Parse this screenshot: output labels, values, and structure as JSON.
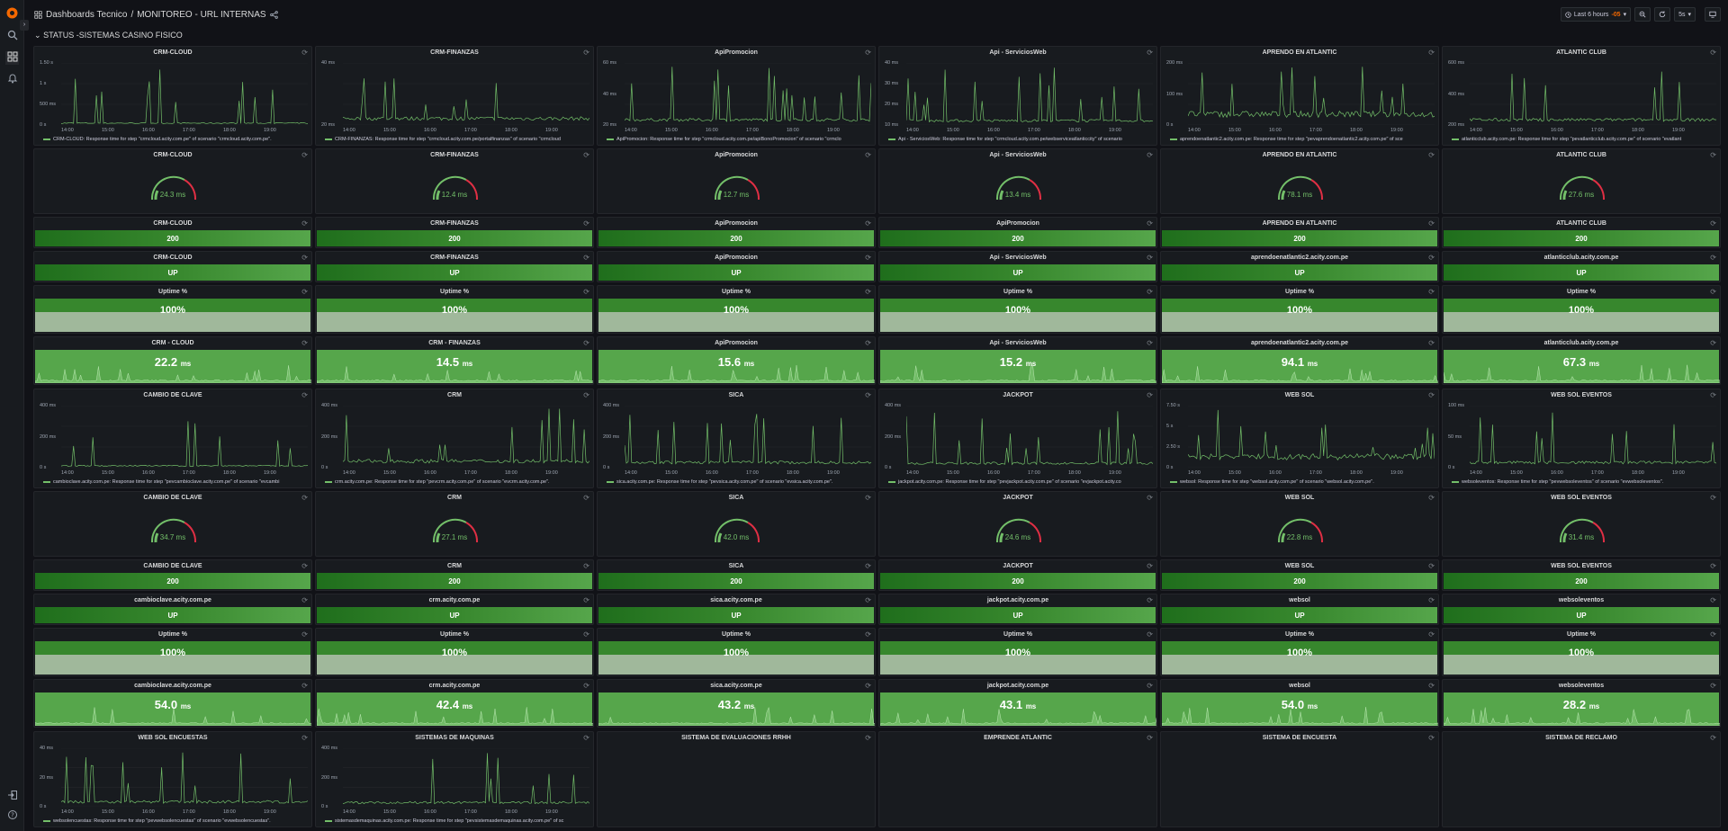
{
  "topbar": {
    "dashboards": "Dashboards Tecnico",
    "sep": "/",
    "dashboard_title": "MONITOREO - URL INTERNAS",
    "time_range": "Last 6 hours",
    "time_suffix": "-05",
    "refresh_interval": "5s"
  },
  "row": {
    "title": "STATUS -SISTEMAS CASINO FISICO"
  },
  "times": [
    "14:00",
    "15:00",
    "16:00",
    "17:00",
    "18:00",
    "19:00"
  ],
  "group1": {
    "graphs": [
      {
        "title": "CRM-CLOUD",
        "y": [
          "1.50 s",
          "1 s",
          "500 ms",
          "0 s"
        ],
        "legend": "CRM-CLOUD: Response time for step \"crmcloud.acity.com.pe\" of scenario \"crmcloud.acity.com.pe\"."
      },
      {
        "title": "CRM-FINANZAS",
        "y": [
          "40 ms",
          "20 ms"
        ],
        "legend": "CRM-FINANZAS: Response time for step \"crmcloud.acity.com.pe/portalfinanzas\" of scenario \"crmcloud"
      },
      {
        "title": "ApiPromocion",
        "y": [
          "60 ms",
          "40 ms",
          "20 ms"
        ],
        "legend": "ApiPromocion: Response time for step \"crmcloud.acity.com.pe/apiBonoPromocion\" of scenario \"crmclo"
      },
      {
        "title": "Api - ServiciosWeb",
        "y": [
          "40 ms",
          "30 ms",
          "20 ms",
          "10 ms"
        ],
        "legend": "Api - ServiciosWeb: Response time for step \"crmcloud.acity.com.pe/webserviceatlanticcity\" of scenario"
      },
      {
        "title": "APRENDO EN ATLANTIC",
        "y": [
          "200 ms",
          "100 ms",
          "0 s"
        ],
        "legend": "aprendoenatlantic2.acity.com.pe: Response time for step \"pevaprendoenatlantic2.acity.com.pe\" of sce"
      },
      {
        "title": "ATLANTIC CLUB",
        "y": [
          "600 ms",
          "400 ms",
          "200 ms"
        ],
        "legend": "atlanticclub.acity.com.pe: Response time for step \"pevatlanticclub.acity.com.pe\" of scenario \"evatlant"
      }
    ],
    "gauges": [
      {
        "title": "CRM-CLOUD",
        "value": "24.3 ms"
      },
      {
        "title": "CRM-FINANZAS",
        "value": "12.4 ms"
      },
      {
        "title": "ApiPromocion",
        "value": "12.7 ms"
      },
      {
        "title": "Api - ServiciosWeb",
        "value": "13.4 ms"
      },
      {
        "title": "APRENDO EN ATLANTIC",
        "value": "78.1 ms"
      },
      {
        "title": "ATLANTIC CLUB",
        "value": "27.6 ms"
      }
    ],
    "codes": [
      {
        "title": "CRM-CLOUD",
        "value": "200"
      },
      {
        "title": "CRM-FINANZAS",
        "value": "200"
      },
      {
        "title": "ApiPromocion",
        "value": "200"
      },
      {
        "title": "ApiPromocion",
        "value": "200"
      },
      {
        "title": "APRENDO EN ATLANTIC",
        "value": "200"
      },
      {
        "title": "ATLANTIC CLUB",
        "value": "200"
      }
    ],
    "status": [
      {
        "title": "CRM-CLOUD",
        "value": "UP"
      },
      {
        "title": "CRM-FINANZAS",
        "value": "UP"
      },
      {
        "title": "ApiPromocion",
        "value": "UP"
      },
      {
        "title": "Api - ServiciosWeb",
        "value": "UP"
      },
      {
        "title": "aprendoenatlantic2.acity.com.pe",
        "value": "UP"
      },
      {
        "title": "atlanticclub.acity.com.pe",
        "value": "UP"
      }
    ],
    "uptime": [
      {
        "title": "Uptime %",
        "value": "100%"
      },
      {
        "title": "Uptime %",
        "value": "100%"
      },
      {
        "title": "Uptime %",
        "value": "100%"
      },
      {
        "title": "Uptime %",
        "value": "100%"
      },
      {
        "title": "Uptime %",
        "value": "100%"
      },
      {
        "title": "Uptime %",
        "value": "100%"
      }
    ],
    "stats": [
      {
        "title": "CRM - CLOUD",
        "value": "22.2",
        "unit": "ms"
      },
      {
        "title": "CRM - FINANZAS",
        "value": "14.5",
        "unit": "ms"
      },
      {
        "title": "ApiPromocion",
        "value": "15.6",
        "unit": "ms"
      },
      {
        "title": "Api - ServiciosWeb",
        "value": "15.2",
        "unit": "ms"
      },
      {
        "title": "aprendoenatlantic2.acity.com.pe",
        "value": "94.1",
        "unit": "ms"
      },
      {
        "title": "atlanticclub.acity.com.pe",
        "value": "67.3",
        "unit": "ms"
      }
    ]
  },
  "group2": {
    "graphs": [
      {
        "title": "CAMBIO DE CLAVE",
        "y": [
          "400 ms",
          "200 ms",
          "0 s"
        ],
        "legend": "cambioclave.acity.com.pe: Response time for step \"pevcambioclave.acity.com.pe\" of scenario \"evcambi"
      },
      {
        "title": "CRM",
        "y": [
          "400 ms",
          "200 ms",
          "0 s"
        ],
        "legend": "crm.acity.com.pe: Response time for step \"pevcrm.acity.com.pe\" of scenario \"evcrm.acity.com.pe\"."
      },
      {
        "title": "SICA",
        "y": [
          "400 ms",
          "200 ms",
          "0 s"
        ],
        "legend": "sica.acity.com.pe: Response time for step \"pevsica.acity.com.pe\" of scenario \"evsica.acity.com.pe\"."
      },
      {
        "title": "JACKPOT",
        "y": [
          "400 ms",
          "200 ms",
          "0 s"
        ],
        "legend": "jackpot.acity.com.pe: Response time for step \"pevjackpot.acity.com.pe\" of scenario \"evjackpot.acity.co"
      },
      {
        "title": "WEB SOL",
        "y": [
          "7.50 s",
          "5 s",
          "2.50 s",
          "0 s"
        ],
        "legend": "websol: Response time for step \"websol.acity.com.pe\" of scenario \"websol.acity.com.pe\"."
      },
      {
        "title": "WEB SOL EVENTOS",
        "y": [
          "100 ms",
          "50 ms",
          "0 s"
        ],
        "legend": "websoleventos: Response time for step \"pevwebsoleventos\" of scenario \"evwebsoleventos\"."
      }
    ],
    "gauges": [
      {
        "title": "CAMBIO DE CLAVE",
        "value": "34.7 ms"
      },
      {
        "title": "CRM",
        "value": "27.1 ms"
      },
      {
        "title": "SICA",
        "value": "42.0 ms"
      },
      {
        "title": "JACKPOT",
        "value": "24.6 ms"
      },
      {
        "title": "WEB SOL",
        "value": "22.8 ms"
      },
      {
        "title": "WEB SOL EVENTOS",
        "value": "31.4 ms"
      }
    ],
    "codes": [
      {
        "title": "CAMBIO DE CLAVE",
        "value": "200"
      },
      {
        "title": "CRM",
        "value": "200"
      },
      {
        "title": "SICA",
        "value": "200"
      },
      {
        "title": "JACKPOT",
        "value": "200"
      },
      {
        "title": "WEB SOL",
        "value": "200"
      },
      {
        "title": "WEB SOL EVENTOS",
        "value": "200"
      }
    ],
    "status": [
      {
        "title": "cambioclave.acity.com.pe",
        "value": "UP"
      },
      {
        "title": "crm.acity.com.pe",
        "value": "UP"
      },
      {
        "title": "sica.acity.com.pe",
        "value": "UP"
      },
      {
        "title": "jackpot.acity.com.pe",
        "value": "UP"
      },
      {
        "title": "websol",
        "value": "UP"
      },
      {
        "title": "websoleventos",
        "value": "UP"
      }
    ],
    "uptime": [
      {
        "title": "Uptime %",
        "value": "100%"
      },
      {
        "title": "Uptime %",
        "value": "100%"
      },
      {
        "title": "Uptime %",
        "value": "100%"
      },
      {
        "title": "Uptime %",
        "value": "100%"
      },
      {
        "title": "Uptime %",
        "value": "100%"
      },
      {
        "title": "Uptime %",
        "value": "100%"
      }
    ],
    "stats": [
      {
        "title": "cambioclave.acity.com.pe",
        "value": "54.0",
        "unit": "ms"
      },
      {
        "title": "crm.acity.com.pe",
        "value": "42.4",
        "unit": "ms"
      },
      {
        "title": "sica.acity.com.pe",
        "value": "43.2",
        "unit": "ms"
      },
      {
        "title": "jackpot.acity.com.pe",
        "value": "43.1",
        "unit": "ms"
      },
      {
        "title": "websol",
        "value": "54.0",
        "unit": "ms"
      },
      {
        "title": "websoleventos",
        "value": "28.2",
        "unit": "ms"
      }
    ]
  },
  "group3": {
    "graphs": [
      {
        "title": "WEB SOL ENCUESTAS",
        "y": [
          "40 ms",
          "20 ms",
          "0 s"
        ],
        "legend": "websolencuestas: Response time for step \"pevwebsolencuestas\" of scenario \"evwebsolencuestas\"."
      },
      {
        "title": "SISTEMAS DE MAQUINAS",
        "y": [
          "400 ms",
          "200 ms",
          "0 s"
        ],
        "legend": "sistemasdemaquinas.acity.com.pe: Response time for step \"pevsistemasdemaquinas.acity.com.pe\" of sc"
      },
      {
        "title": "SISTEMA DE EVALUACIONES RRHH",
        "y": [],
        "legend": ""
      },
      {
        "title": "EMPRENDE ATLANTIC",
        "y": [],
        "legend": ""
      },
      {
        "title": "SISTEMA DE ENCUESTA",
        "y": [],
        "legend": ""
      },
      {
        "title": "SISTEMA DE RECLAMO",
        "y": [],
        "legend": ""
      }
    ]
  },
  "colors": {
    "green": "#73bf69",
    "dark_green": "#37872d",
    "red": "#e02f44",
    "panel": "#181b1f",
    "bg": "#111217"
  },
  "icons": {
    "menu": "grafana-logo-icon",
    "search": "search-icon",
    "dashboards": "dashboards-icon",
    "alerts": "bell-icon",
    "signin": "signin-icon",
    "help": "help-icon",
    "refresh": "refresh-icon"
  }
}
